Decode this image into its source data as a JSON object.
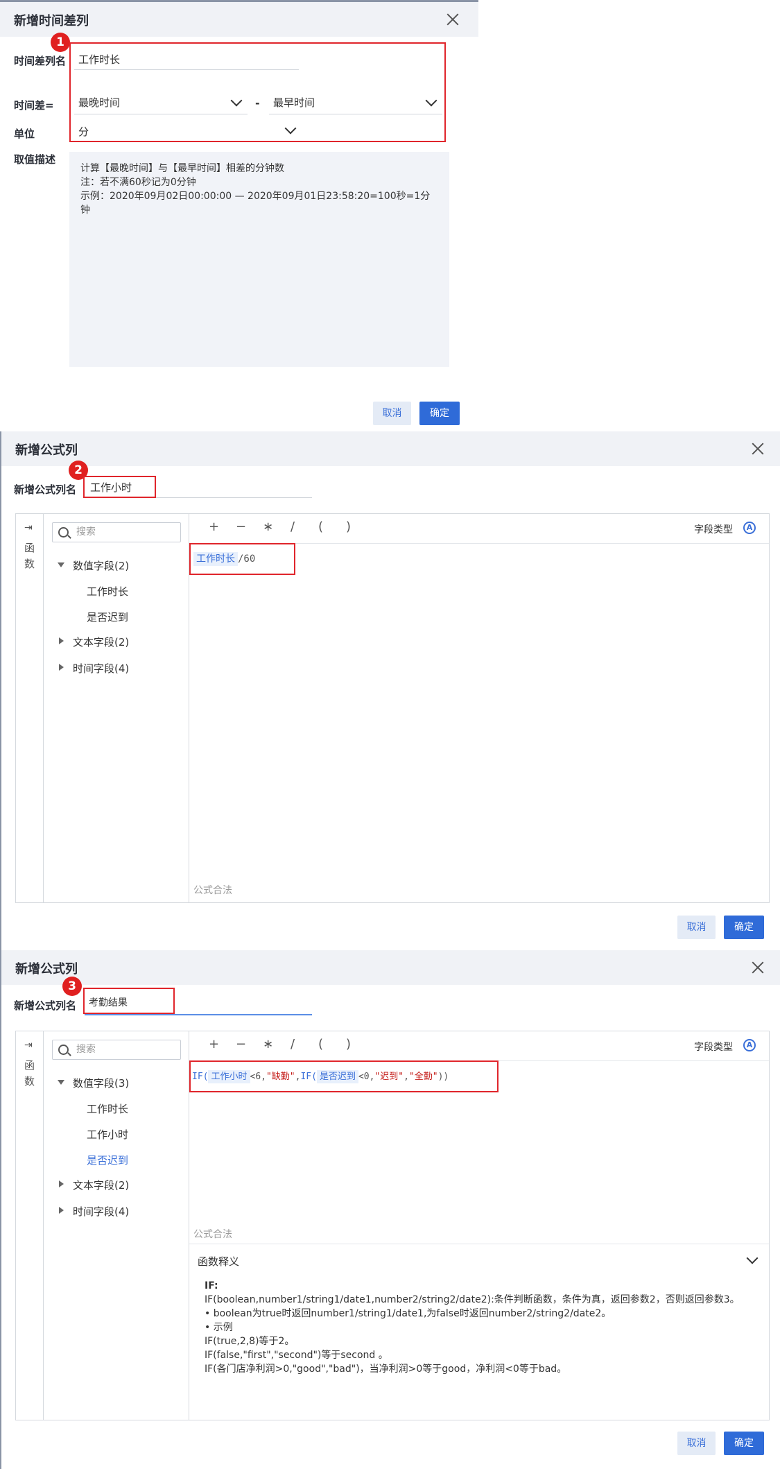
{
  "panel1": {
    "title": "新增时间差列",
    "name_label": "时间差列名",
    "name_value": "工作时长",
    "diff_label": "时间差=",
    "left_field": "最晚时间",
    "minus": "-",
    "right_field": "最早时间",
    "unit_label": "单位",
    "unit_value": "分",
    "desc_label": "取值描述",
    "desc_line1": "计算【最晚时间】与【最早时间】相差的分钟数",
    "desc_line2": "注：若不满60秒记为0分钟",
    "desc_line3": "示例：2020年09月02日00:00:00 — 2020年09月01日23:58:20=100秒=1分钟",
    "cancel": "取消",
    "ok": "确定",
    "badge": "1"
  },
  "panel2": {
    "title": "新增公式列",
    "name_label": "新增公式列名",
    "name_value": "工作小时",
    "badge": "2",
    "fn_label": "函数",
    "search_placeholder": "搜索",
    "tree": {
      "numeric": "数值字段(2)",
      "numeric_items": [
        "工作时长",
        "是否迟到"
      ],
      "text": "文本字段(2)",
      "time": "时间字段(4)"
    },
    "ops": [
      "+",
      "−",
      "∗",
      "/",
      "(",
      ")"
    ],
    "field_type": "字段类型",
    "formula_chip": "工作时长",
    "formula_rest": "/60",
    "status": "公式合法",
    "cancel": "取消",
    "ok": "确定"
  },
  "panel3": {
    "title": "新增公式列",
    "name_label": "新增公式列名",
    "name_value": "考勤结果",
    "badge": "3",
    "fn_label": "函数",
    "search_placeholder": "搜索",
    "tree": {
      "numeric": "数值字段(3)",
      "numeric_items": [
        "工作时长",
        "工作小时",
        "是否迟到"
      ],
      "text": "文本字段(2)",
      "time": "时间字段(4)"
    },
    "ops": [
      "+",
      "−",
      "∗",
      "/",
      "(",
      ")"
    ],
    "field_type": "字段类型",
    "formula": {
      "if1": "IF(",
      "chip1": "工作小时",
      "p1": "<6,",
      "s1": "\"缺勤\"",
      "p2": ",",
      "if2": "IF(",
      "chip2": "是否迟到",
      "p3": "<0,",
      "s2": "\"迟到\"",
      "p4": ",",
      "s3": "\"全勤\"",
      "p5": "))"
    },
    "status": "公式合法",
    "explain_title": "函数释义",
    "explain_lines": [
      "IF:",
      "IF(boolean,number1/string1/date1,number2/string2/date2):条件判断函数，条件为真，返回参数2，否则返回参数3。",
      "• boolean为true时返回number1/string1/date1,为false时返回number2/string2/date2。",
      "• 示例",
      "IF(true,2,8)等于2。",
      "IF(false,\"first\",\"second\")等于second 。",
      "IF(各门店净利润>0,\"good\",\"bad\")，当净利润>0等于good，净利润<0等于bad。"
    ],
    "cancel": "取消",
    "ok": "确定"
  }
}
